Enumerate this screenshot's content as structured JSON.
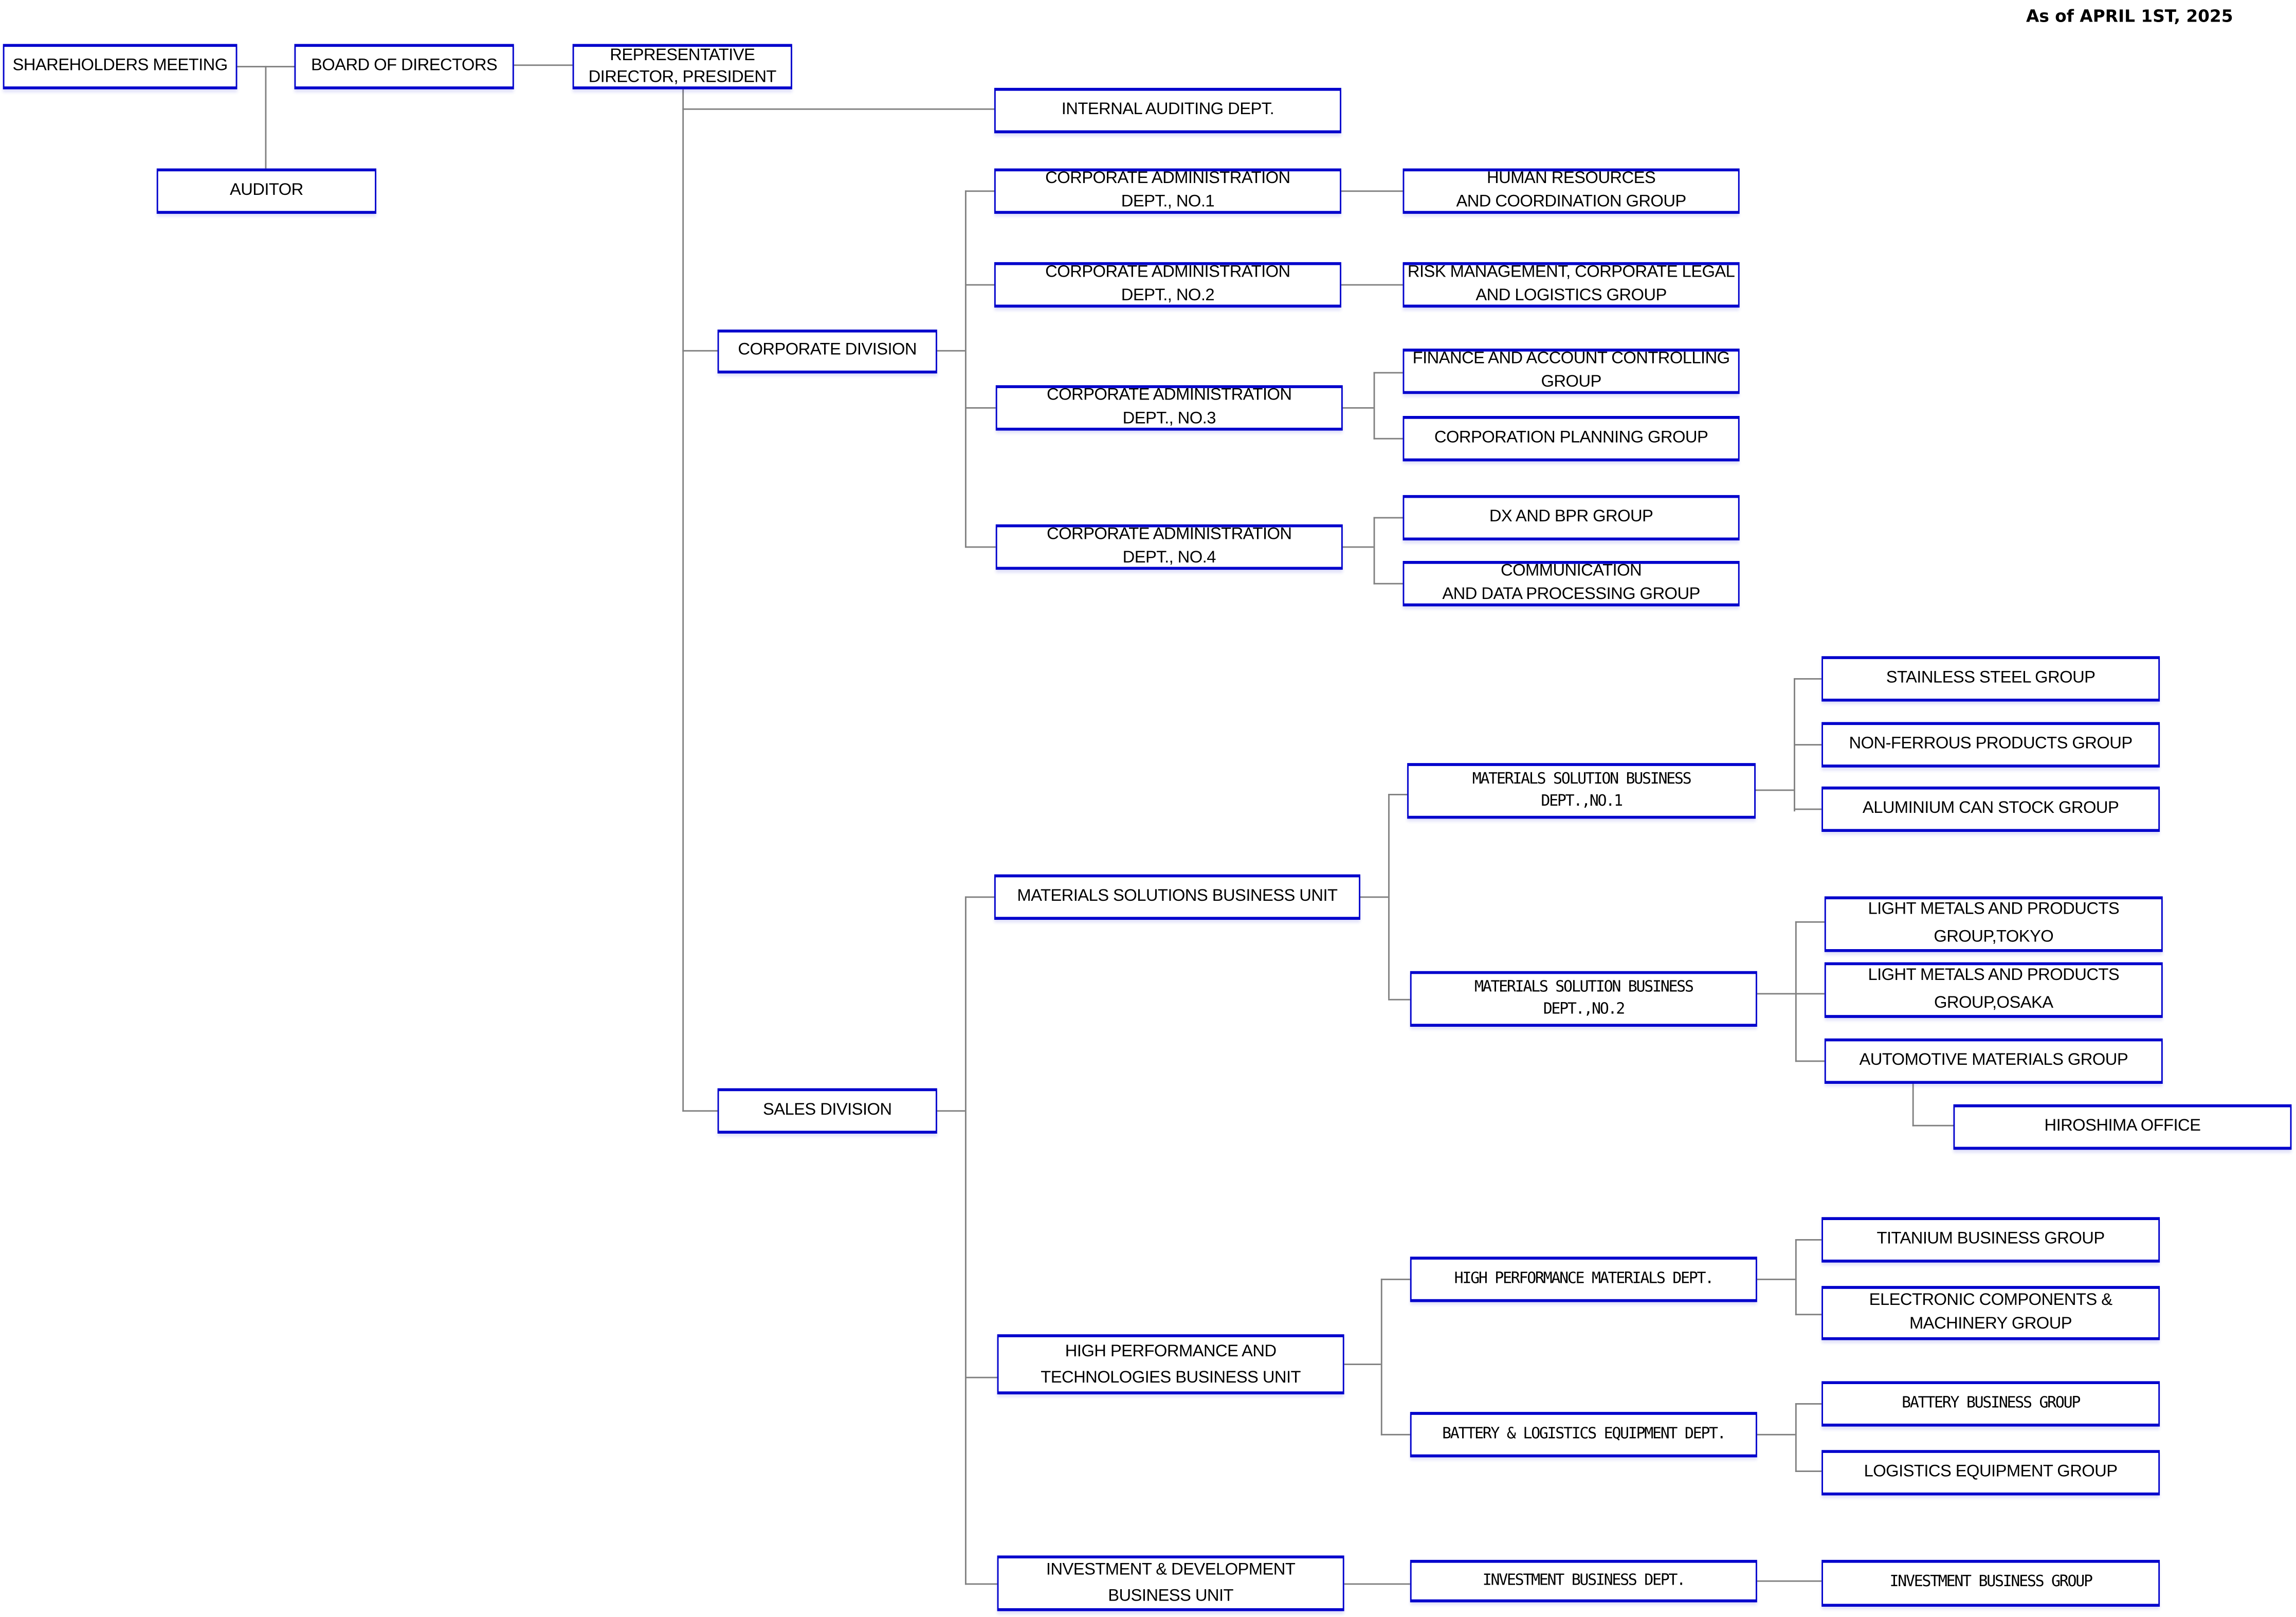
{
  "header": {
    "as_of": "As of APRIL 1ST, 2025"
  },
  "colors": {
    "box_border": "#0000cc",
    "connector": "#808080",
    "text": "#000000",
    "background": "#ffffff"
  },
  "governance": {
    "shareholders_meeting": "SHAREHOLDERS MEETING",
    "board_of_directors": "BOARD OF DIRECTORS",
    "auditor": "AUDITOR",
    "president": "REPRESENTATIVE\nDIRECTOR, PRESIDENT"
  },
  "internal_auditing": "INTERNAL AUDITING DEPT.",
  "corporate_division": {
    "label": "CORPORATE DIVISION",
    "depts": [
      {
        "label": "CORPORATE ADMINISTRATION\nDEPT.,  NO.1",
        "groups": [
          "HUMAN RESOURCES\nAND COORDINATION GROUP"
        ]
      },
      {
        "label": "CORPORATE ADMINISTRATION\nDEPT.,  NO.2",
        "groups": [
          "RISK MANAGEMENT, CORPORATE LEGAL\nAND LOGISTICS GROUP"
        ]
      },
      {
        "label": "CORPORATE ADMINISTRATION\nDEPT.,  NO.3",
        "groups": [
          "FINANCE AND ACCOUNT CONTROLLING\nGROUP",
          "CORPORATION PLANNING GROUP"
        ]
      },
      {
        "label": "CORPORATE ADMINISTRATION\nDEPT.,  NO.4",
        "groups": [
          "DX AND BPR GROUP",
          "COMMUNICATION\nAND DATA PROCESSING GROUP"
        ]
      }
    ]
  },
  "sales_division": {
    "label": "SALES DIVISION",
    "units": [
      {
        "label": "MATERIALS SOLUTIONS BUSINESS UNIT",
        "depts": [
          {
            "label": "MATERIALS SOLUTION BUSINESS\nDEPT.,NO.1",
            "groups": [
              "STAINLESS STEEL GROUP",
              "NON-FERROUS PRODUCTS GROUP",
              "ALUMINIUM CAN STOCK GROUP"
            ]
          },
          {
            "label": "MATERIALS SOLUTION BUSINESS\nDEPT.,NO.2",
            "groups": [
              "LIGHT METALS AND PRODUCTS\nGROUP,TOKYO",
              "LIGHT METALS AND PRODUCTS\nGROUP,OSAKA",
              "AUTOMOTIVE MATERIALS GROUP"
            ],
            "offices": [
              "HIROSHIMA OFFICE"
            ]
          }
        ]
      },
      {
        "label": "HIGH PERFORMANCE AND\nTECHNOLOGIES BUSINESS UNIT",
        "depts": [
          {
            "label": "HIGH PERFORMANCE MATERIALS DEPT.",
            "groups": [
              "TITANIUM BUSINESS GROUP",
              "ELECTRONIC COMPONENTS &\nMACHINERY GROUP"
            ]
          },
          {
            "label": "BATTERY & LOGISTICS EQUIPMENT DEPT.",
            "groups": [
              "BATTERY BUSINESS GROUP",
              "LOGISTICS EQUIPMENT GROUP"
            ]
          }
        ]
      },
      {
        "label": "INVESTMENT & DEVELOPMENT\nBUSINESS UNIT",
        "depts": [
          {
            "label": "INVESTMENT BUSINESS DEPT.",
            "groups": [
              "INVESTMENT BUSINESS GROUP"
            ]
          }
        ]
      }
    ]
  }
}
